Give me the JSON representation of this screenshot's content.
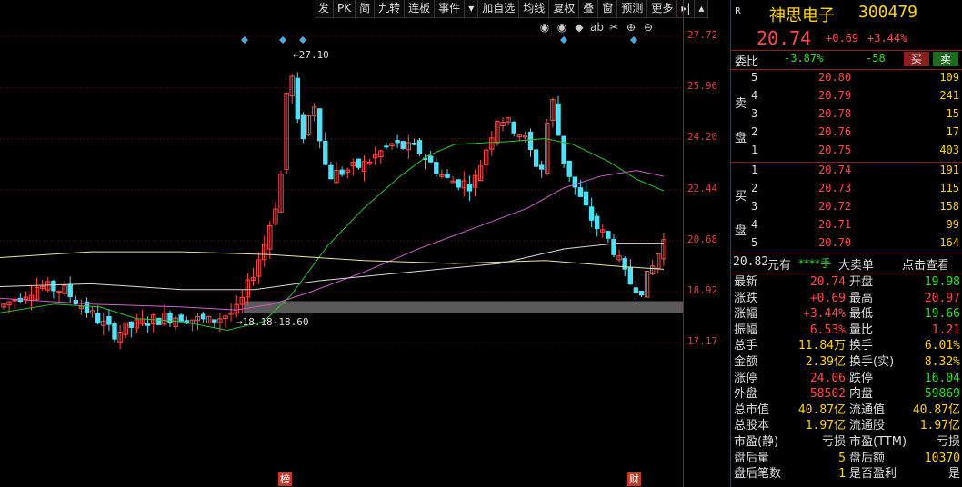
{
  "toolbar": [
    "发",
    "PK",
    "简",
    "九转",
    "连板",
    "事件",
    "▾",
    "加自选",
    "均线",
    "复权",
    "叠",
    "窗",
    "预测",
    "更多",
    "▸|",
    "▴"
  ],
  "chart_icons": [
    "eye-icon",
    "eye-icon",
    "pin-icon",
    "ab-icon",
    "scissors-icon",
    "plus-icon",
    "minus-icon"
  ],
  "axis_ticks": [
    "27.72",
    "25.96",
    "24.20",
    "22.44",
    "20.68",
    "18.92",
    "17.17"
  ],
  "axis_values": [
    27.72,
    25.96,
    24.2,
    22.44,
    20.68,
    18.92,
    17.17
  ],
  "annotations": {
    "high": "27.10",
    "zone": "18.18-18.60"
  },
  "bottom_labels": [
    "榜",
    "财"
  ],
  "colors": {
    "up": "#ff4a4a",
    "down": "#4fe1f7",
    "ma_green": "#30c030",
    "ma_magenta": "#d060d0",
    "ma_yellow": "#e6e6a0",
    "ma_white": "#d8d8d8",
    "zone": "#5a5a5a"
  },
  "stock": {
    "badge": "R",
    "name": "神思电子",
    "code": "300479",
    "price": "20.74",
    "change": "+0.69",
    "pct": "+3.44%"
  },
  "ratio": {
    "label": "委比",
    "pct": "-3.87%",
    "diff": "-58",
    "buy_btn": "买",
    "sell_btn": "卖"
  },
  "sell_side_label": [
    "卖",
    "盘"
  ],
  "buy_side_label": [
    "买",
    "盘"
  ],
  "asks": [
    {
      "lvl": "5",
      "price": "20.80",
      "vol": "109"
    },
    {
      "lvl": "4",
      "price": "20.79",
      "vol": "241"
    },
    {
      "lvl": "3",
      "price": "20.78",
      "vol": "15"
    },
    {
      "lvl": "2",
      "price": "20.76",
      "vol": "17"
    },
    {
      "lvl": "1",
      "price": "20.75",
      "vol": "403"
    }
  ],
  "bids": [
    {
      "lvl": "1",
      "price": "20.74",
      "vol": "191"
    },
    {
      "lvl": "2",
      "price": "20.73",
      "vol": "115"
    },
    {
      "lvl": "3",
      "price": "20.72",
      "vol": "158"
    },
    {
      "lvl": "4",
      "price": "20.71",
      "vol": "99"
    },
    {
      "lvl": "5",
      "price": "20.70",
      "vol": "164"
    }
  ],
  "bigorder": {
    "price": "20.82",
    "unit": "元有",
    "amount": "****手",
    "label": "大卖单",
    "link": "点击查看"
  },
  "stats": [
    {
      "l1": "最新",
      "v1": "20.74",
      "c1": "red",
      "l2": "开盘",
      "v2": "19.98",
      "c2": "green"
    },
    {
      "l1": "涨跌",
      "v1": "+0.69",
      "c1": "red",
      "l2": "最高",
      "v2": "20.97",
      "c2": "red"
    },
    {
      "l1": "涨幅",
      "v1": "+3.44%",
      "c1": "red",
      "l2": "最低",
      "v2": "19.66",
      "c2": "green"
    },
    {
      "l1": "振幅",
      "v1": "6.53%",
      "c1": "red",
      "l2": "量比",
      "v2": "1.21",
      "c2": "red"
    },
    {
      "l1": "总手",
      "v1": "11.84万",
      "c1": "yellow",
      "l2": "换手",
      "v2": "6.01%",
      "c2": "yellow"
    },
    {
      "l1": "金额",
      "v1": "2.39亿",
      "c1": "yellow",
      "l2": "换手(实)",
      "v2": "8.32%",
      "c2": "yellow"
    },
    {
      "l1": "涨停",
      "v1": "24.06",
      "c1": "red",
      "l2": "跌停",
      "v2": "16.04",
      "c2": "green"
    },
    {
      "l1": "外盘",
      "v1": "58502",
      "c1": "red",
      "l2": "内盘",
      "v2": "59869",
      "c2": "green"
    },
    {
      "l1": "总市值",
      "v1": "40.87亿",
      "c1": "yellow",
      "l2": "流通值",
      "v2": "40.87亿",
      "c2": "yellow"
    },
    {
      "l1": "总股本",
      "v1": "1.97亿",
      "c1": "yellow",
      "l2": "流通股",
      "v2": "1.97亿",
      "c2": "yellow"
    },
    {
      "l1": "市盈(静)",
      "v1": "亏损",
      "c1": "white",
      "l2": "市盈(TTM)",
      "v2": "亏损",
      "c2": "white"
    },
    {
      "l1": "盘后量",
      "v1": "5",
      "c1": "yellow",
      "l2": "盘后额",
      "v2": "10370",
      "c2": "yellow"
    },
    {
      "l1": "盘后笔数",
      "v1": "1",
      "c1": "yellow",
      "l2": "是否盈利",
      "v2": "是",
      "c2": "white"
    }
  ]
}
